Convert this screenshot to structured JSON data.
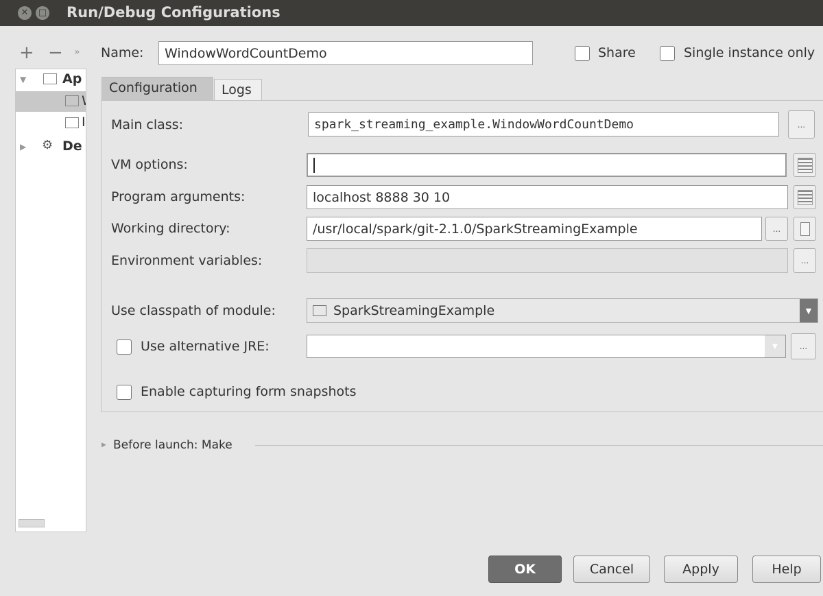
{
  "window": {
    "title": "Run/Debug Configurations"
  },
  "toolbar": {
    "add": "+",
    "remove": "−",
    "more": "»"
  },
  "tree": {
    "items": [
      {
        "label": "Ap"
      },
      {
        "label": "W"
      },
      {
        "label": "I"
      },
      {
        "label": "De"
      }
    ]
  },
  "name": {
    "label": "Name:",
    "value": "WindowWordCountDemo"
  },
  "share": {
    "label": "Share",
    "checked": false
  },
  "single_instance": {
    "label": "Single instance only",
    "checked": false
  },
  "tabs": [
    {
      "label": "Configuration"
    },
    {
      "label": "Logs"
    }
  ],
  "form": {
    "main_class": {
      "label": "Main class:",
      "value": "spark_streaming_example.WindowWordCountDemo"
    },
    "vm_options": {
      "label": "VM options:",
      "value": ""
    },
    "program_arguments": {
      "label": "Program arguments:",
      "value": "localhost 8888 30 10"
    },
    "working_directory": {
      "label": "Working directory:",
      "value": "/usr/local/spark/git-2.1.0/SparkStreamingExample"
    },
    "environment_variables": {
      "label": "Environment variables:",
      "value": ""
    },
    "classpath_module": {
      "label": "Use classpath of module:",
      "value": "SparkStreamingExample"
    },
    "alternative_jre": {
      "label": "Use alternative JRE:",
      "value": "",
      "checked": false
    },
    "capture_snapshots": {
      "label": "Enable capturing form snapshots",
      "checked": false
    }
  },
  "before_launch": {
    "label": "Before launch: Make"
  },
  "buttons": {
    "ok": "OK",
    "cancel": "Cancel",
    "apply": "Apply",
    "help": "Help",
    "ellipsis": "..."
  }
}
